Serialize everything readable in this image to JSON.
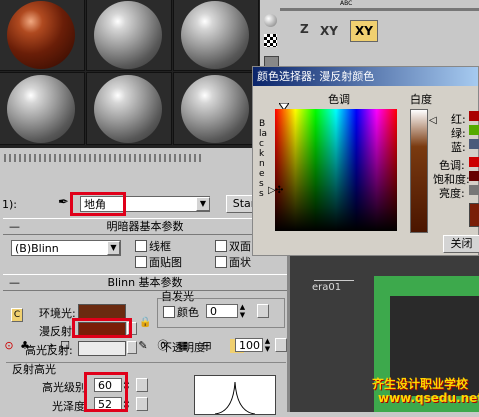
{
  "toolbar": {
    "material_name": "地角",
    "standard_label": "Star",
    "level_prefix": "1):"
  },
  "shader_basic": {
    "title": "明暗器基本参数",
    "shader": "(B)Blinn",
    "wire": "线框",
    "two_sided": "双面",
    "face_map": "面贴图",
    "faceted": "面状"
  },
  "blinn_basic": {
    "title": "Blinn 基本参数",
    "ambient": "环境光:",
    "diffuse": "漫反射:",
    "specular": "高光反射:",
    "self_illum": "自发光",
    "color": "颜色",
    "self_illum_value": "0",
    "opacity": "不透明度:",
    "opacity_value": "100",
    "lock_letter_top": "C",
    "ambient_color": "#6b2a10",
    "diffuse_color": "#7a1e08",
    "specular_color": "#ebebeb"
  },
  "highlights": {
    "title": "反射高光",
    "level_label": "高光级别",
    "level_value": "60",
    "gloss_label": "光泽度",
    "gloss_value": "52"
  },
  "viewport": {
    "label": "era01",
    "toolbar_xy": "XY",
    "toolbar_xy2": "XY",
    "toolbar_z": "Z",
    "small_text": "ABC"
  },
  "color_dialog": {
    "title": "颜色选择器: 漫反射颜色",
    "hue_label": "色调",
    "white_label": "白度",
    "blackness_label": "Blackness",
    "red": "红:",
    "green": "绿:",
    "blue": "蓝:",
    "hue": "色调:",
    "saturation": "饱和度:",
    "value": "亮度:",
    "close": "关闭"
  },
  "watermark": {
    "line1": "齐生设计职业学校",
    "line2": "www.qsedu.net"
  }
}
